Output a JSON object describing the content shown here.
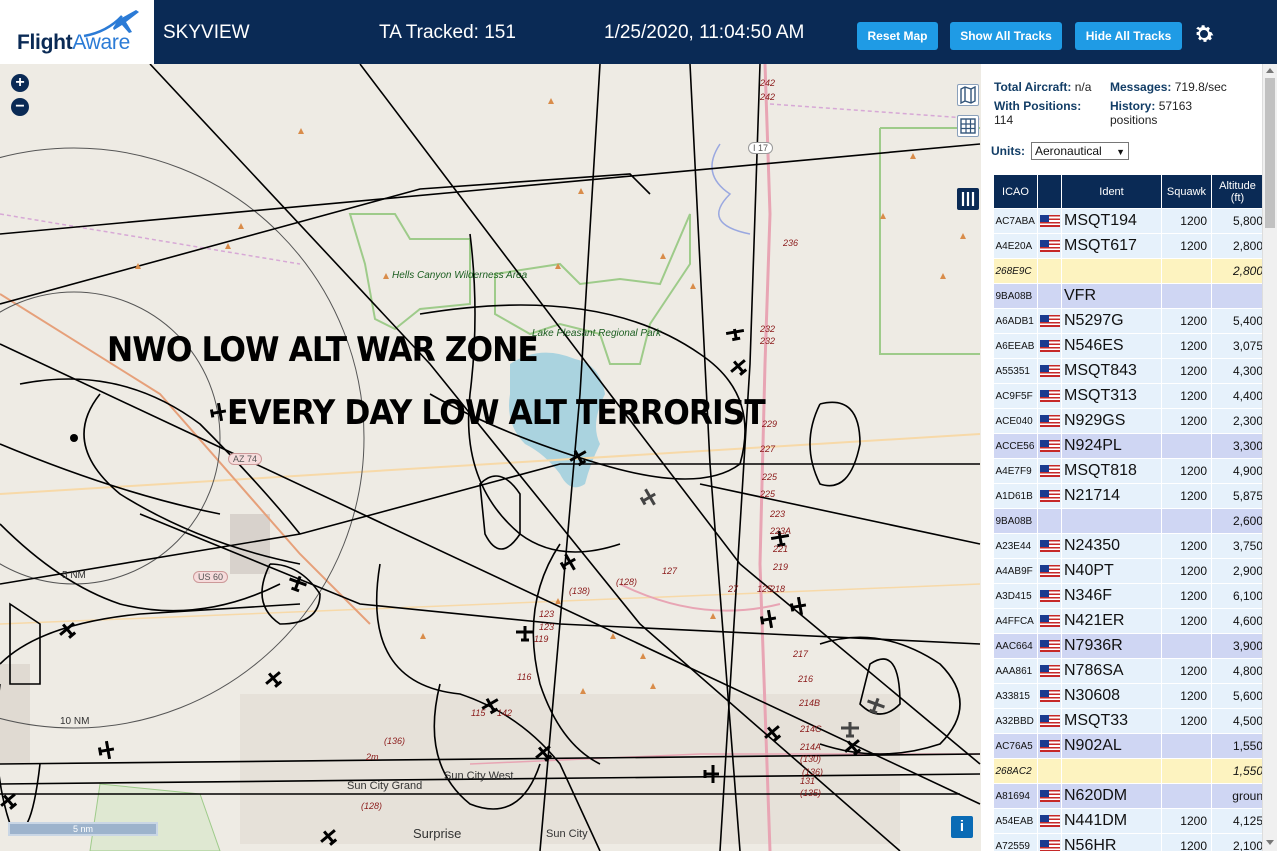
{
  "header": {
    "logo_flight": "Flight",
    "logo_aware": "Aware",
    "title": "SKYVIEW",
    "tracked": "TA Tracked: 151",
    "datetime": "1/25/2020, 11:04:50 AM",
    "reset_map": "Reset Map",
    "show_all": "Show All Tracks",
    "hide_all": "Hide All Tracks",
    "settings_icon": "gear-icon"
  },
  "map": {
    "zoom_in": "+",
    "zoom_out": "−",
    "overlay_line1": "NWO LOW ALT WAR ZONE",
    "overlay_line2": "EVERY DAY LOW ALT TERRORIST",
    "scale": "5 nm",
    "info": "i",
    "labels": {
      "hells_canyon": "Hells Canyon Wilderness Area",
      "lake_pleasant": "Lake Pleasant Regional Park",
      "sun_city_west": "Sun City West",
      "sun_city_grand": "Sun City Grand",
      "sun_city": "Sun City",
      "surprise": "Surprise",
      "ring_5nm": "5 NM",
      "ring_10nm": "10 NM",
      "us60": "US 60",
      "az74": "AZ 74",
      "i17": "I 17"
    },
    "road_labels": [
      "242",
      "242",
      "236",
      "232",
      "232",
      "229",
      "227",
      "225",
      "225",
      "223",
      "223A",
      "221",
      "219",
      "218",
      "217",
      "216",
      "214B",
      "214C",
      "214A",
      "(130)",
      "131",
      "(135)",
      "(136)",
      "(138)",
      "(128)",
      "127",
      "27",
      "125",
      "123",
      "123",
      "119",
      "116",
      "115",
      "142",
      "(136)",
      "2m",
      "(128)"
    ]
  },
  "sidebar": {
    "total_label": "Total Aircraft:",
    "total_value": "n/a",
    "messages_label": "Messages:",
    "messages_value": "719.8/sec",
    "positions_label": "With Positions:",
    "positions_value": "114",
    "history_label": "History:",
    "history_value": "57163 positions",
    "units_label": "Units:",
    "units_value": "Aeronautical",
    "columns": [
      "ICAO",
      "",
      "Ident",
      "Squawk",
      "Altitude (ft)"
    ],
    "rows": [
      {
        "icao": "AC7ABA",
        "flag": true,
        "ident": "MSQT194",
        "squawk": "1200",
        "alt": "5,800",
        "type": "adsb"
      },
      {
        "icao": "A4E20A",
        "flag": true,
        "ident": "MSQT617",
        "squawk": "1200",
        "alt": "2,800",
        "type": "adsb"
      },
      {
        "icao": "268E9C",
        "flag": false,
        "ident": "",
        "squawk": "",
        "alt": "2,800",
        "type": "tisb"
      },
      {
        "icao": "9BA08B",
        "flag": false,
        "ident": "VFR",
        "squawk": "",
        "alt": "",
        "type": "mlat"
      },
      {
        "icao": "A6ADB1",
        "flag": true,
        "ident": "N5297G",
        "squawk": "1200",
        "alt": "5,400",
        "type": "adsb"
      },
      {
        "icao": "A6EEAB",
        "flag": true,
        "ident": "N546ES",
        "squawk": "1200",
        "alt": "3,075",
        "type": "adsb"
      },
      {
        "icao": "A55351",
        "flag": true,
        "ident": "MSQT843",
        "squawk": "1200",
        "alt": "4,300",
        "type": "adsb"
      },
      {
        "icao": "AC9F5F",
        "flag": true,
        "ident": "MSQT313",
        "squawk": "1200",
        "alt": "4,400",
        "type": "adsb"
      },
      {
        "icao": "ACE040",
        "flag": true,
        "ident": "N929GS",
        "squawk": "1200",
        "alt": "2,300",
        "type": "adsb"
      },
      {
        "icao": "ACCE56",
        "flag": true,
        "ident": "N924PL",
        "squawk": "",
        "alt": "3,300",
        "type": "mlat"
      },
      {
        "icao": "A4E7F9",
        "flag": true,
        "ident": "MSQT818",
        "squawk": "1200",
        "alt": "4,900",
        "type": "adsb"
      },
      {
        "icao": "A1D61B",
        "flag": true,
        "ident": "N21714",
        "squawk": "1200",
        "alt": "5,875",
        "type": "adsb"
      },
      {
        "icao": "9BA08B",
        "flag": false,
        "ident": "",
        "squawk": "",
        "alt": "2,600",
        "type": "mlat"
      },
      {
        "icao": "A23E44",
        "flag": true,
        "ident": "N24350",
        "squawk": "1200",
        "alt": "3,750",
        "type": "adsb"
      },
      {
        "icao": "A4AB9F",
        "flag": true,
        "ident": "N40PT",
        "squawk": "1200",
        "alt": "2,900",
        "type": "adsb"
      },
      {
        "icao": "A3D415",
        "flag": true,
        "ident": "N346F",
        "squawk": "1200",
        "alt": "6,100",
        "type": "adsb"
      },
      {
        "icao": "A4FFCA",
        "flag": true,
        "ident": "N421ER",
        "squawk": "1200",
        "alt": "4,600",
        "type": "adsb"
      },
      {
        "icao": "AAC664",
        "flag": true,
        "ident": "N7936R",
        "squawk": "",
        "alt": "3,900",
        "type": "mlat"
      },
      {
        "icao": "AAA861",
        "flag": true,
        "ident": "N786SA",
        "squawk": "1200",
        "alt": "4,800",
        "type": "adsb"
      },
      {
        "icao": "A33815",
        "flag": true,
        "ident": "N30608",
        "squawk": "1200",
        "alt": "5,600",
        "type": "adsb"
      },
      {
        "icao": "A32BBD",
        "flag": true,
        "ident": "MSQT33",
        "squawk": "1200",
        "alt": "4,500",
        "type": "adsb"
      },
      {
        "icao": "AC76A5",
        "flag": true,
        "ident": "N902AL",
        "squawk": "",
        "alt": "1,550",
        "type": "mlat"
      },
      {
        "icao": "268AC2",
        "flag": false,
        "ident": "",
        "squawk": "",
        "alt": "1,550",
        "type": "tisb"
      },
      {
        "icao": "A81694",
        "flag": true,
        "ident": "N620DM",
        "squawk": "",
        "alt": "groun",
        "type": "mlat"
      },
      {
        "icao": "A54EAB",
        "flag": true,
        "ident": "N441DM",
        "squawk": "1200",
        "alt": "4,125",
        "type": "adsb"
      },
      {
        "icao": "A72559",
        "flag": true,
        "ident": "N56HR",
        "squawk": "1200",
        "alt": "2,100",
        "type": "adsb"
      }
    ]
  }
}
